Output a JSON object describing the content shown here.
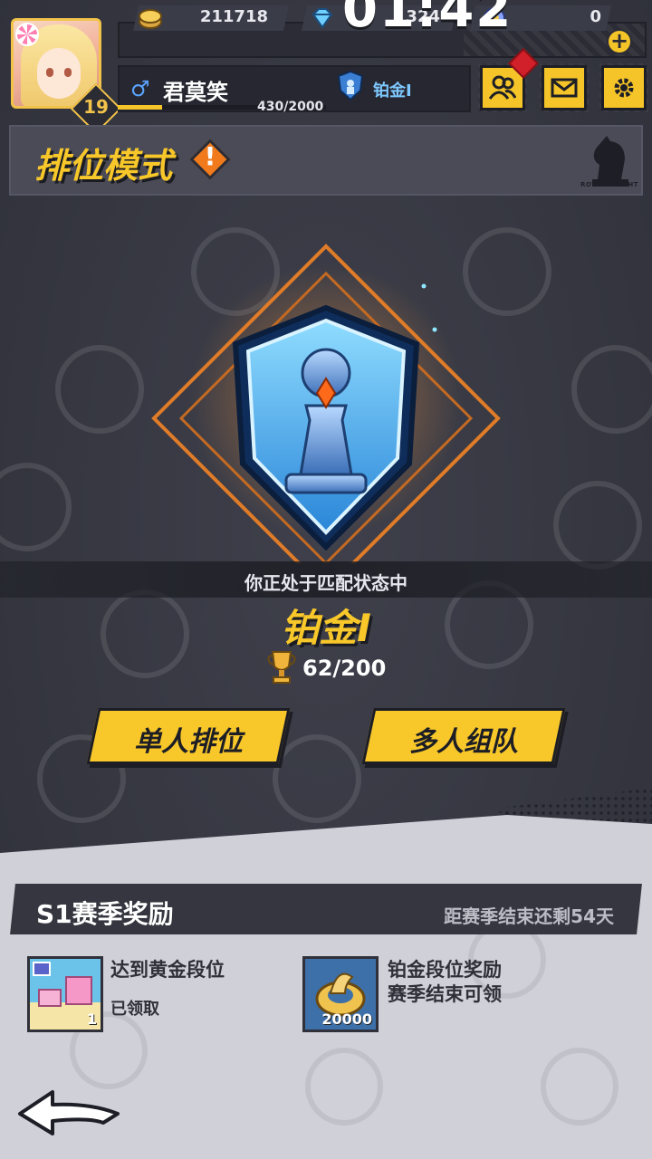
{
  "hud": {
    "timer": "01:42",
    "level": "19",
    "resources": [
      {
        "name": "gold",
        "icon": "gold-coin-icon",
        "value": "211718"
      },
      {
        "name": "diamond",
        "icon": "diamond-icon",
        "value": "324"
      },
      {
        "name": "token",
        "icon": "token-icon",
        "value": "0"
      }
    ],
    "player": {
      "gender_symbol": "♂",
      "name": "君莫笑",
      "rank": "铂金I",
      "xp_text": "430/2000",
      "xp_fraction": 0.215
    },
    "buttons": [
      "friends-button",
      "mail-button",
      "settings-button"
    ]
  },
  "mode": {
    "title": "排位模式",
    "info_mark": "!",
    "logo_text": "ROYAL KNIGHT"
  },
  "rank_panel": {
    "status": "你正处于匹配状态中",
    "rank_name": "铂金I",
    "points": "62/200"
  },
  "actions": {
    "solo": "单人排位",
    "team": "多人组队"
  },
  "season": {
    "title": "S1赛季奖励",
    "remaining": "距赛季结束还剩54天",
    "rewards": [
      {
        "title": "达到黄金段位",
        "sub": "已领取",
        "qty": "1"
      },
      {
        "title": "铂金段位奖励",
        "sub": "赛季结束可领",
        "qty": "20000"
      }
    ]
  },
  "colors": {
    "accent_yellow": "#f8c72a",
    "background": "#34353f",
    "rank_blue": "#7ec8ff",
    "alert_red": "#d2202a"
  }
}
